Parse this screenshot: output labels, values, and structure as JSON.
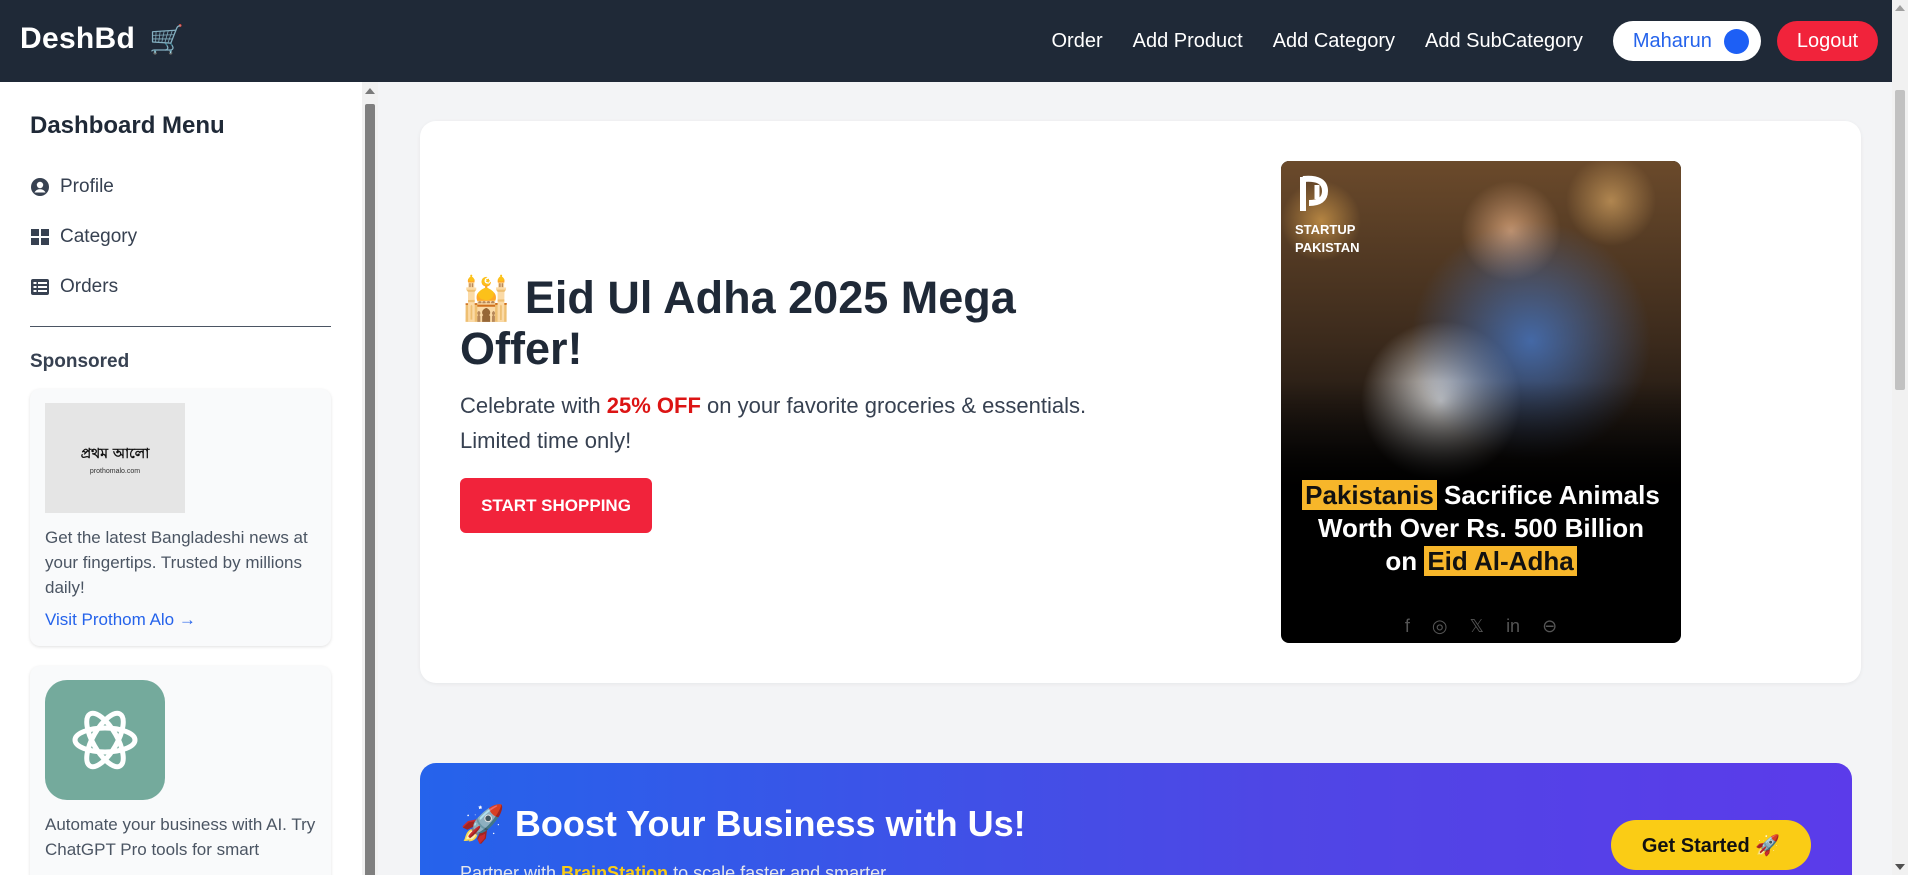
{
  "header": {
    "brand": "DeshBd",
    "brand_icon": "cart-icon",
    "nav": {
      "order": "Order",
      "add_product": "Add Product",
      "add_category": "Add Category",
      "add_subcategory": "Add SubCategory"
    },
    "user_name": "Maharun",
    "logout": "Logout"
  },
  "sidebar": {
    "title": "Dashboard Menu",
    "items": [
      {
        "label": "Profile",
        "icon": "user-circle-icon"
      },
      {
        "label": "Category",
        "icon": "grid-icon"
      },
      {
        "label": "Orders",
        "icon": "list-icon"
      }
    ],
    "sponsored_title": "Sponsored",
    "sponsors": [
      {
        "logo_text": "প্রথম আলো",
        "logo_domain": "prothomalo.com",
        "text": "Get the latest Bangladeshi news at your fingertips. Trusted by millions daily!",
        "link": "Visit Prothom Alo →"
      },
      {
        "logo_icon": "openai-icon",
        "text": "Automate your business with AI. Try ChatGPT Pro tools for smart"
      }
    ]
  },
  "hero": {
    "icon": "🕌",
    "title": "Eid Ul Adha 2025 Mega Offer!",
    "sub_before": "Celebrate with ",
    "sub_highlight": "25% OFF",
    "sub_after": " on your favorite groceries & essentials.",
    "sub_line2": "Limited time only!",
    "button": "START SHOPPING"
  },
  "promo": {
    "logo_line1": "STARTUP",
    "logo_line2": "PAKISTAN",
    "hl1": "Pakistanis",
    "text1": " Sacrifice Animals",
    "text2": "Worth Over Rs. 500 Billion",
    "text3": "on ",
    "hl2": "Eid Al-Adha",
    "social": [
      "f",
      "◎",
      "𝕏",
      "in",
      "⊖"
    ]
  },
  "boost": {
    "icon": "🚀",
    "title": "Boost Your Business with Us!",
    "sub_before": "Partner with ",
    "sub_highlight": "BrainStation",
    "sub_after": " to scale faster and smarter.",
    "button": "Get Started 🚀"
  },
  "colors": {
    "topbar": "#1f2937",
    "accent_red": "#f1233b",
    "link_blue": "#2563eb",
    "highlight_yellow": "#facc15"
  }
}
